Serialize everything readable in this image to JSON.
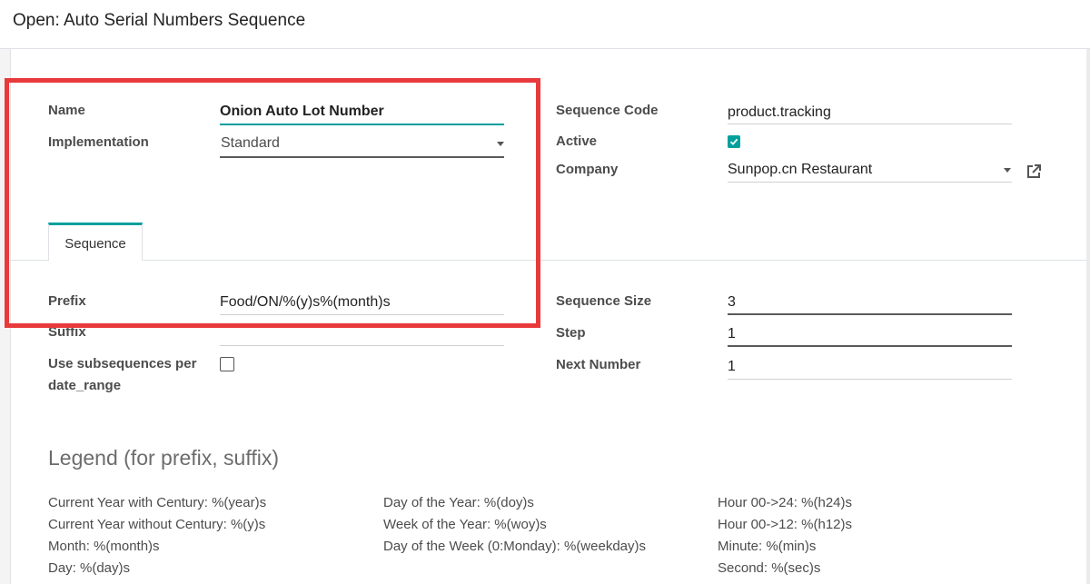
{
  "dialog": {
    "title": "Open: Auto Serial Numbers Sequence"
  },
  "form": {
    "name": {
      "label": "Name",
      "value": "Onion Auto Lot Number"
    },
    "implementation": {
      "label": "Implementation",
      "value": "Standard"
    },
    "sequence_code": {
      "label": "Sequence Code",
      "value": "product.tracking"
    },
    "active": {
      "label": "Active",
      "checked": true
    },
    "company": {
      "label": "Company",
      "value": "Sunpop.cn Restaurant"
    }
  },
  "tabs": [
    {
      "label": "Sequence",
      "active": true
    }
  ],
  "sequence_tab": {
    "prefix": {
      "label": "Prefix",
      "value": "Food/ON/%(y)s%(month)s"
    },
    "suffix": {
      "label": "Suffix",
      "value": ""
    },
    "use_subsequences": {
      "label_line1": "Use subsequences per",
      "label_line2": "date_range",
      "checked": false
    },
    "sequence_size": {
      "label": "Sequence Size",
      "value": "3"
    },
    "step": {
      "label": "Step",
      "value": "1"
    },
    "next_number": {
      "label": "Next Number",
      "value": "1"
    }
  },
  "legend": {
    "title": "Legend (for prefix, suffix)",
    "col1": [
      "Current Year with Century: %(year)s",
      "Current Year without Century: %(y)s",
      "Month: %(month)s",
      "Day: %(day)s"
    ],
    "col2": [
      "Day of the Year: %(doy)s",
      "Week of the Year: %(woy)s",
      "Day of the Week (0:Monday): %(weekday)s"
    ],
    "col3": [
      "Hour 00->24: %(h24)s",
      "Hour 00->12: %(h12)s",
      "Minute: %(min)s",
      "Second: %(sec)s"
    ]
  },
  "colors": {
    "accent": "#00a09d",
    "highlight": "#e8393b"
  }
}
